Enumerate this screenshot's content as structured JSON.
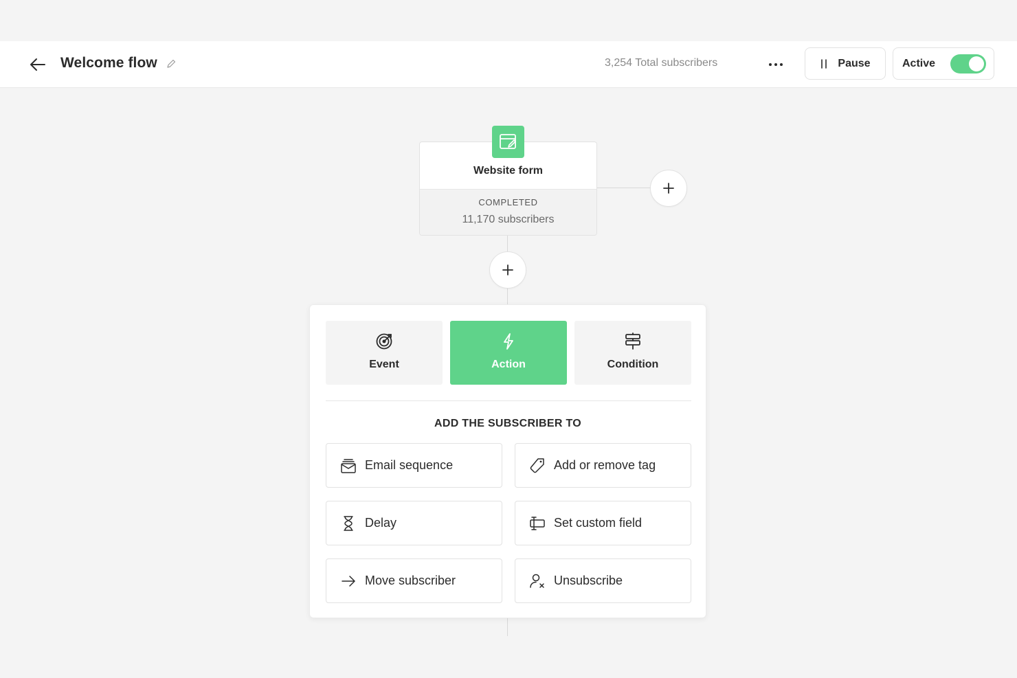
{
  "header": {
    "title": "Welcome flow",
    "total_subscribers": "3,254 Total subscribers",
    "pause_label": "Pause",
    "active_label": "Active",
    "active_on": true
  },
  "trigger": {
    "name": "Website form",
    "status": "COMPLETED",
    "subscribers": "11,170 subscribers",
    "icon": "form-edit-icon"
  },
  "step_types": [
    {
      "label": "Event",
      "icon": "target-icon",
      "selected": false
    },
    {
      "label": "Action",
      "icon": "lightning-icon",
      "selected": true
    },
    {
      "label": "Condition",
      "icon": "signpost-icon",
      "selected": false
    }
  ],
  "section_title": "ADD THE SUBSCRIBER TO",
  "options": [
    {
      "label": "Email sequence",
      "icon": "email-stack-icon"
    },
    {
      "label": "Add or remove tag",
      "icon": "tag-icon"
    },
    {
      "label": "Delay",
      "icon": "hourglass-icon"
    },
    {
      "label": "Set custom field",
      "icon": "custom-field-icon"
    },
    {
      "label": "Move subscriber",
      "icon": "arrow-right-icon"
    },
    {
      "label": "Unsubscribe",
      "icon": "user-remove-icon"
    }
  ],
  "colors": {
    "accent": "#5fd38a",
    "background": "#f4f4f4",
    "text": "#2b2b2b"
  }
}
